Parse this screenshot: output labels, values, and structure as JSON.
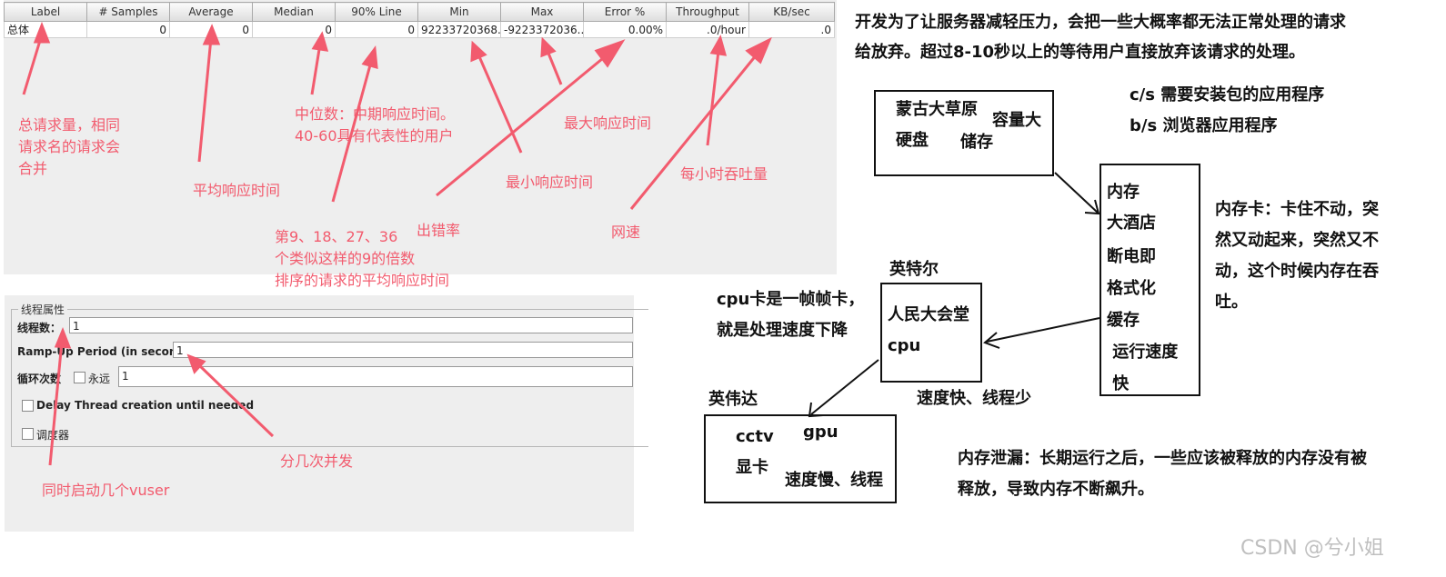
{
  "report": {
    "columns": [
      "Label",
      "# Samples",
      "Average",
      "Median",
      "90% Line",
      "Min",
      "Max",
      "Error %",
      "Throughput",
      "KB/sec"
    ],
    "row": [
      "总体",
      "0",
      "0",
      "0",
      "0",
      "92233720368...",
      "-9223372036...",
      "0.00%",
      ".0/hour",
      ".0"
    ]
  },
  "report_notes": {
    "samples": "总请求量，相同\n请求名的请求会\n合并",
    "average": "平均响应时间",
    "median": "中位数：中期响应时间。\n40-60具有代表性的用户",
    "line90": "第9、18、27、36\n个类似这样的9的倍数\n排序的请求的平均响应时间",
    "error": "出错率",
    "min": "最小响应时间",
    "max": "最大响应时间",
    "throughput": "每小时吞吐量",
    "kbsec": "网速"
  },
  "thread_group": {
    "legend": "线程属性",
    "threads_label": "线程数：",
    "threads_value": "1",
    "rampup_label": "Ramp-Up Period (in seconds):",
    "rampup_value": "1",
    "loop_label": "循环次数",
    "forever_label": "永远",
    "loop_value": "1",
    "delay_label": "Delay Thread creation until needed",
    "scheduler_label": "调度器"
  },
  "thread_notes": {
    "rampup": "分几次并发",
    "threads": "同时启动几个vuser"
  },
  "notes": {
    "intro": "开发为了让服务器减轻压力，会把一些大概率都无法正常处理的请求\n给放弃。超过8-10秒以上的等待用户直接放弃该请求的处理。",
    "cs": "c/s 需要安装包的应用程序",
    "bs": "b/s 浏览器应用程序",
    "disk_box": {
      "line1": "蒙古大草原",
      "line2": "硬盘",
      "capacity": "容量大",
      "storage": "储存"
    },
    "memory_box": [
      "内存",
      "大酒店",
      "断电即",
      "格式化",
      "缓存",
      " 运行速度",
      " 快"
    ],
    "memory_card": "内存卡：卡住不动，突\n然又动起来，突然又不\n动，这个时候内存在吞\n吐。",
    "intel": "英特尔",
    "cpu_box": {
      "line1": "人民大会堂",
      "line2": "cpu"
    },
    "cpu_card": "cpu卡是一帧帧卡，\n就是处理速度下降",
    "cpu_speed": "速度快、线程少",
    "nvidia": "英伟达",
    "gpu_box": {
      "cctv": "cctv",
      "gpu": "gpu",
      "card": "显卡",
      "speed": "速度慢、线程"
    },
    "leak": "内存泄漏：长期运行之后，一些应该被释放的内存没有被\n释放，导致内存不断飙升。"
  },
  "watermark": "CSDN @兮小姐"
}
